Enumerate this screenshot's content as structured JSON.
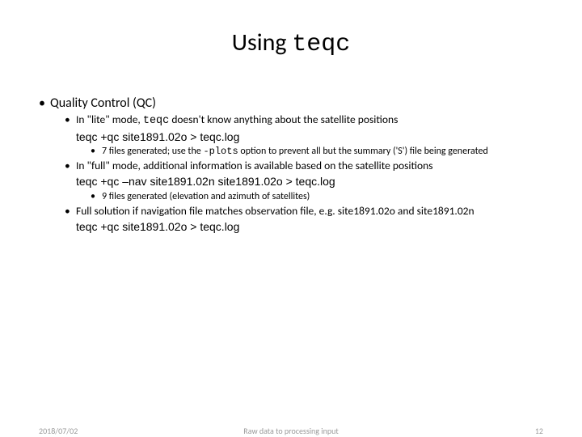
{
  "title": {
    "prefix": "Using ",
    "cmd": "teqc"
  },
  "b1": {
    "heading": "Quality Control (QC)"
  },
  "b2a": {
    "pre": "In \"lite\" mode, ",
    "mono": "teqc",
    "post": " doesn't know anything about the satellite positions",
    "cmd": "teqc +qc site1891.02o > teqc.log"
  },
  "b3a": {
    "pre": "7 files generated; use the ",
    "mono": "-plots",
    "post": " option to prevent all but the summary ('S') file being generated"
  },
  "b2b": {
    "text": "In \"full\" mode, additional information is available based on the satellite positions",
    "cmd": "teqc +qc –nav site1891.02n site1891.02o > teqc.log"
  },
  "b3b": {
    "text": "9 files generated (elevation and azimuth of satellites)"
  },
  "b2c": {
    "pre1": "Full solution if navigation file matches observation file, e.g. ",
    "f1": "site1891.02o",
    "mid": " and ",
    "f2": "site1891.02n",
    "cmd": "teqc +qc site1891.02o > teqc.log"
  },
  "footer": {
    "date": "2018/07/02",
    "title": "Raw data to processing input",
    "page": "12"
  }
}
